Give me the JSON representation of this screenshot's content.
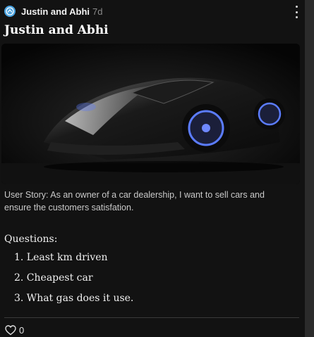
{
  "post": {
    "author": "Justin and Abhi",
    "age": "7d",
    "title": "Justin and Abhi",
    "image_alt": "Black sports car",
    "story": "User Story: As an owner of a car dealership, I want to sell cars and ensure the customers satisfation.",
    "questions_heading": "Questions:",
    "questions": [
      "1. Least km driven",
      "2. Cheapest car",
      "3. What gas does it use."
    ],
    "likes": "0"
  },
  "icons": {
    "avatar": "avatar-icon",
    "menu": "more-vertical-icon",
    "like": "heart-outline-icon"
  },
  "colors": {
    "avatar": "#4aa3e0",
    "background": "#121212",
    "accent_headlight": "#5b7cff"
  }
}
